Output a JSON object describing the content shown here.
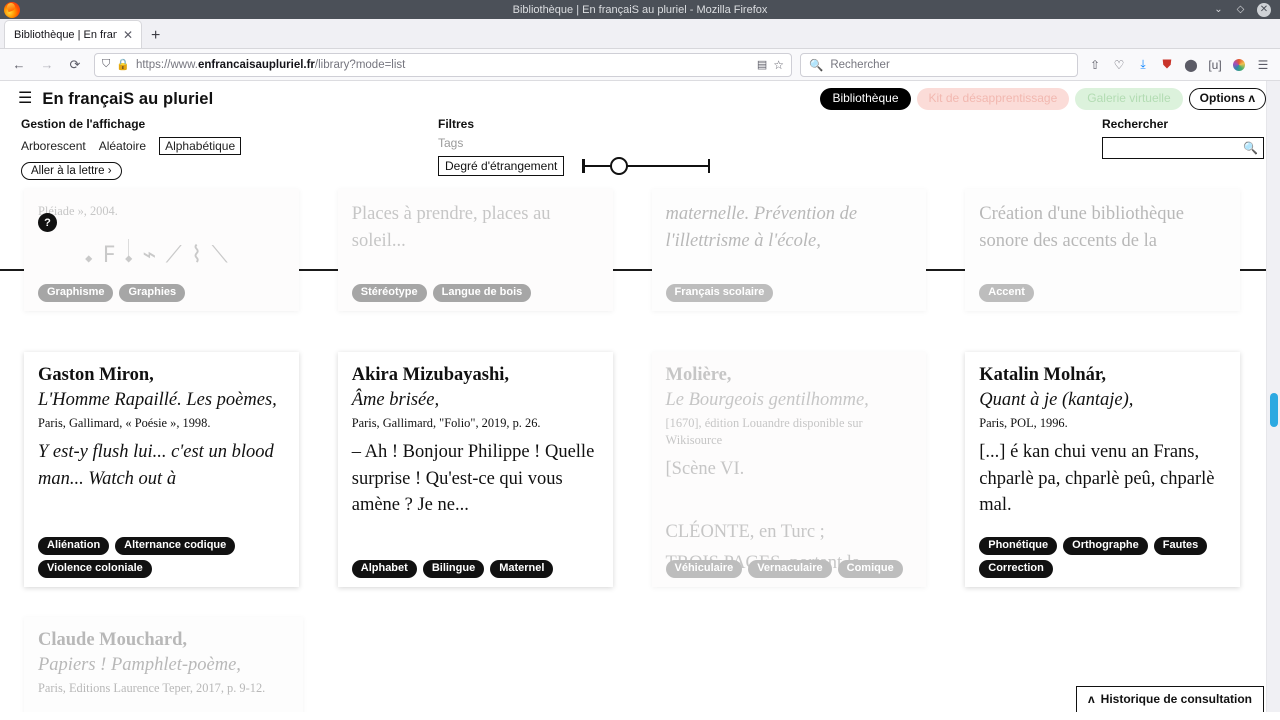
{
  "browser": {
    "window_title": "Bibliothèque | En françaiS au pluriel - Mozilla Firefox",
    "tab_title": "Bibliothèque | En françaiS au",
    "tab_close": "✕",
    "new_tab": "+",
    "url_prefix": "https://www.",
    "url_domain": "enfrancaisaupluriel.fr",
    "url_path": "/library?mode=list",
    "search_placeholder": "Rechercher",
    "nav": {
      "back": "←",
      "forward": "→",
      "reload": "⟳"
    },
    "window_buttons": {
      "minimize": "⌄",
      "maximize": "◇",
      "close": "✕"
    }
  },
  "header": {
    "menu_icon": "hamburger-icon",
    "site_title": "En françaiS au pluriel",
    "pills": [
      {
        "label": "Bibliothèque",
        "style": "active"
      },
      {
        "label": "Kit de désapprentissage",
        "style": "pinkish"
      },
      {
        "label": "Galerie virtuelle",
        "style": "greenish"
      },
      {
        "label": "Options ʌ",
        "style": "outline"
      }
    ]
  },
  "controls": {
    "display": {
      "title": "Gestion de l'affichage",
      "options": [
        {
          "label": "Arborescent",
          "selected": false
        },
        {
          "label": "Aléatoire",
          "selected": false
        },
        {
          "label": "Alphabétique",
          "selected": true
        }
      ],
      "letter_button": "Aller à la lettre ›"
    },
    "filters": {
      "title": "Filtres",
      "tags_label": "Tags",
      "slider_label": "Degré d'étrangement",
      "slider_value": 22
    },
    "search": {
      "title": "Rechercher",
      "value": "",
      "icon": "search-icon"
    }
  },
  "cards": {
    "top_row": [
      {
        "ref": "Pléiade », 2004.",
        "badge": "?",
        "glyphs": "𝆺 𝈓 𝆺𝅥 ⌁ ⟋   ⌇ ⟍",
        "tags": [
          "Graphisme",
          "Graphies"
        ],
        "state": "faded"
      },
      {
        "title": "Places à prendre, places au soleil...",
        "tags": [
          "Stéréotype",
          "Langue de bois"
        ],
        "state": "faded"
      },
      {
        "title": "maternelle. Prévention de l'illettrisme à l'école,",
        "tags": [
          "Français scolaire"
        ],
        "state": "faded"
      },
      {
        "title": "Création d'une bibliothèque sonore des accents de la",
        "tags": [
          "Accent"
        ],
        "state": "faded"
      }
    ],
    "main_row": [
      {
        "author": "Gaston Miron,",
        "title": "L'Homme Rapaillé. Les poèmes,",
        "ref": "Paris, Gallimard, « Poésie », 1998.",
        "quote": "Y est-y flush lui... c'est un blood man... Watch out à",
        "quote_italic": true,
        "tags": [
          "Aliénation",
          "Alternance codique",
          "Violence coloniale"
        ],
        "state": "normal"
      },
      {
        "author": "Akira Mizubayashi,",
        "title": "Âme brisée,",
        "ref": "Paris, Gallimard, \"Folio\", 2019, p. 26.",
        "quote": "– Ah ! Bonjour Philippe ! Quelle surprise ! Qu'est-ce qui vous amène ? Je ne...",
        "quote_italic": false,
        "tags": [
          "Alphabet",
          "Bilingue",
          "Maternel"
        ],
        "state": "normal"
      },
      {
        "author": "Molière,",
        "title": "Le Bourgeois gentilhomme,",
        "ref": "[1670], édition Louandre disponible sur Wikisource",
        "quote": "[Scène VI.\n\nCLÉONTE, en Turc ;\nTROIS PAGES, portant la",
        "quote_italic": false,
        "tags": [
          "Véhiculaire",
          "Vernaculaire",
          "Comique"
        ],
        "state": "faded"
      },
      {
        "author": "Katalin Molnár,",
        "title": "Quant à je (kantaje),",
        "ref": "Paris, POL, 1996.",
        "quote": "[...] é kan chui venu an Frans, chparlè pa, chparlè peû, chparlè mal.",
        "quote_italic": false,
        "tags": [
          "Phonétique",
          "Orthographe",
          "Fautes",
          "Correction"
        ],
        "state": "normal"
      }
    ],
    "bottom_row": [
      {
        "author": "Claude Mouchard,",
        "title": "Papiers ! Pamphlet-poème,",
        "ref": "Paris, Editions Laurence Teper, 2017, p. 9-12.",
        "state": "faded"
      }
    ]
  },
  "footer": {
    "history_button": "Historique de consultation",
    "history_caret": "ʌ"
  },
  "colors": {
    "accent_black": "#000000",
    "pill_pink": "#fbdcd8",
    "pill_green": "#dcf2dc",
    "scrollbar_thumb": "#2ca9e1",
    "chrome_titlebar": "#4b5058"
  }
}
